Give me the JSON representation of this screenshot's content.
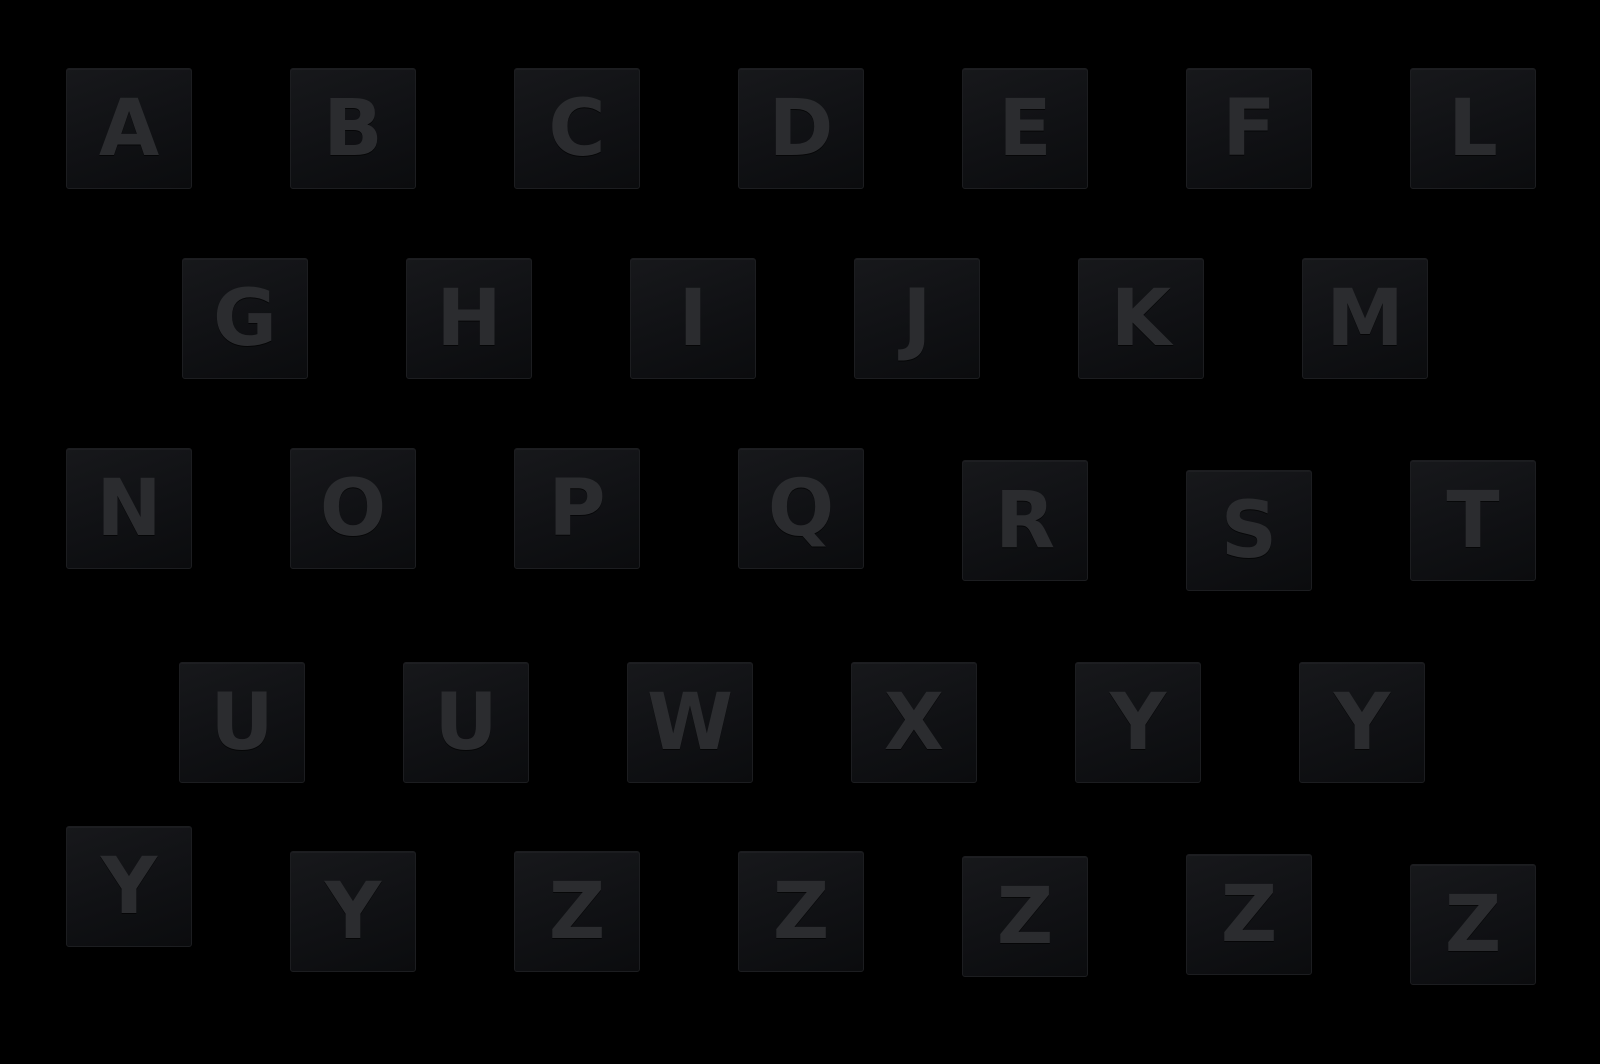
{
  "tiles": [
    {
      "letter": "A"
    },
    {
      "letter": "B"
    },
    {
      "letter": "C"
    },
    {
      "letter": "D"
    },
    {
      "letter": "E"
    },
    {
      "letter": "F"
    },
    {
      "letter": "L"
    },
    {
      "letter": "G"
    },
    {
      "letter": "H"
    },
    {
      "letter": "I"
    },
    {
      "letter": "J"
    },
    {
      "letter": "K"
    },
    {
      "letter": "M"
    },
    {
      "letter": "N"
    },
    {
      "letter": "O"
    },
    {
      "letter": "P"
    },
    {
      "letter": "Q"
    },
    {
      "letter": "R"
    },
    {
      "letter": "S"
    },
    {
      "letter": "T"
    },
    {
      "letter": "U"
    },
    {
      "letter": "U"
    },
    {
      "letter": "W"
    },
    {
      "letter": "X"
    },
    {
      "letter": "Y"
    },
    {
      "letter": "Y"
    },
    {
      "letter": "Y"
    },
    {
      "letter": "Y"
    },
    {
      "letter": "Z"
    },
    {
      "letter": "Z"
    },
    {
      "letter": "Z"
    },
    {
      "letter": "Z"
    },
    {
      "letter": "Z"
    }
  ],
  "colors": {
    "background": "#000000",
    "tile": "#111215",
    "glyph": "#2b2c2f"
  }
}
